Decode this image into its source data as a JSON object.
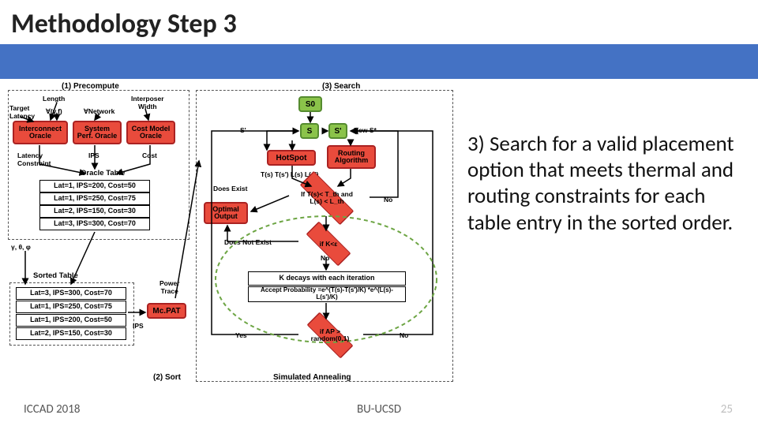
{
  "title": "Methodology Step 3",
  "body_text": "3) Search for a valid placement option that meets thermal and routing constraints for each table entry in the sorted order.",
  "footer": {
    "left": "ICCAD 2018",
    "center": "BU-UCSD",
    "page": "25"
  },
  "diagram": {
    "groups": {
      "g1": "(1) Precompute",
      "g3": "(3) Search",
      "sort": "(2) Sort",
      "sa": "Simulated Annealing"
    },
    "inputs": {
      "len": "Length",
      "vf": "∀(v,f)",
      "net": "∀Network",
      "iw": "Interposer\nWidth",
      "tl": "Target\nLatency"
    },
    "oracles": {
      "io": "Interconnect\nOracle",
      "spo": "System\nPerf. Oracle",
      "cmo": "Cost Model\nOracle"
    },
    "mid": {
      "latc": "Latency\nConstraint",
      "ips": "IPS",
      "cost": "Cost",
      "otable": "Oracle Table",
      "mcpat": "Mc.PAT",
      "ptrace": "Power\nTrace",
      "gtp": "γ, θ, φ"
    },
    "otable_rows": [
      "Lat=1, IPS=200, Cost=50",
      "Lat=1, IPS=250, Cost=75",
      "Lat=2, IPS=150, Cost=30",
      "Lat=3, IPS=300, Cost=70"
    ],
    "sorted_label": "Sorted Table",
    "sorted_rows": [
      "Lat=3, IPS=300, Cost=70",
      "Lat=1, IPS=250, Cost=75",
      "Lat=1, IPS=200, Cost=50",
      "Lat=2, IPS=150, Cost=30"
    ],
    "search": {
      "s0": "S0",
      "s": "S",
      "sprime_l": "S'",
      "sprime_r": "S'",
      "newS": "New S*",
      "hotspot": "HotSpot",
      "routing": "Routing\nAlgorithm",
      "ts_label": "T(s) T(s')          L(s) L(s')",
      "exist": "Does Exist",
      "cond": "If T(s)< T_th and\nL(s) < L_th",
      "optout": "Optimal\nOutput",
      "dne": "Does Not Exist",
      "keps": "if K<ε",
      "no1": "No",
      "no2": "No",
      "kdecay": "K decays with each iteration",
      "accept_prob": "Accept Probability =e^(T(s)-T(s')/K) *e^(L(s)-L(s')/K)",
      "yes": "Yes",
      "ap": "if AP >\nrandom(0,1)",
      "no3": "No"
    }
  }
}
